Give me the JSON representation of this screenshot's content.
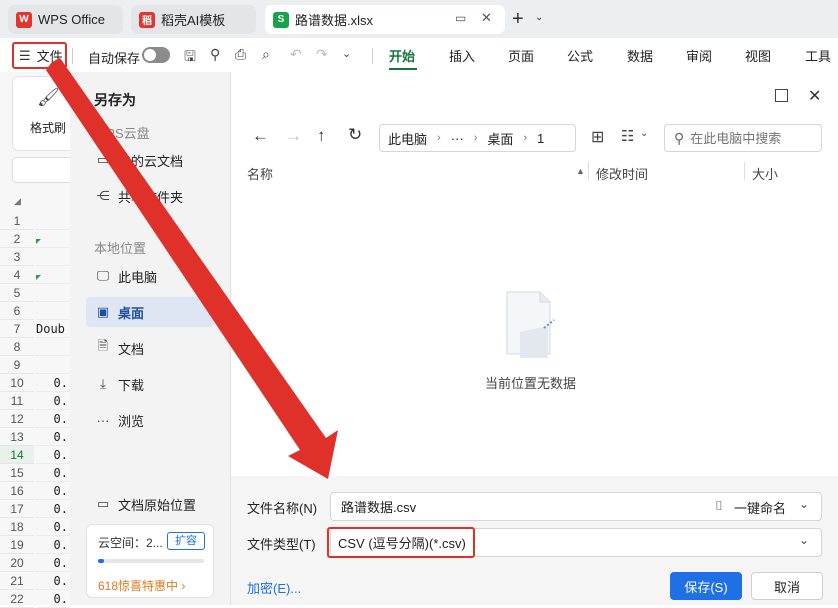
{
  "tabs": [
    {
      "label": "WPS Office",
      "icon": "wps-logo-icon"
    },
    {
      "label": "稻壳AI模板",
      "icon": "docer-logo-icon"
    },
    {
      "label": "路谱数据.xlsx",
      "icon": "spreadsheet-icon",
      "badge": "S"
    }
  ],
  "ribbon": {
    "file_menu": "文件",
    "autosave": "自动保存",
    "menu_tabs": [
      "开始",
      "插入",
      "页面",
      "公式",
      "数据",
      "审阅",
      "视图",
      "工具"
    ],
    "format_painter": "格式刷"
  },
  "sheet": {
    "rows": [
      "1",
      "2",
      "3",
      "4",
      "5",
      "6",
      "7",
      "8",
      "9",
      "10",
      "11",
      "12",
      "13",
      "14",
      "15",
      "16",
      "17",
      "18",
      "19",
      "20",
      "21",
      "22"
    ],
    "row7_text": "Doub",
    "value_prefix": "0."
  },
  "dialog": {
    "title": "另存为",
    "cloud_section": "WPS云盘",
    "cloud_items": [
      {
        "label": "我的云文档",
        "icon": "cloud-folder-icon"
      },
      {
        "label": "共享文件夹",
        "icon": "share-icon"
      }
    ],
    "local_section": "本地位置",
    "local_items": [
      {
        "label": "此电脑",
        "icon": "monitor-icon"
      },
      {
        "label": "桌面",
        "icon": "desktop-icon"
      },
      {
        "label": "文档",
        "icon": "document-icon"
      },
      {
        "label": "下载",
        "icon": "download-icon"
      },
      {
        "label": "浏览",
        "icon": "more-icon"
      }
    ],
    "original_location": "文档原始位置",
    "cloud_space": "云空间：2...",
    "expand": "扩容",
    "promo": "618惊喜特惠中 ›",
    "breadcrumb": [
      "此电脑",
      "···",
      "桌面",
      "1"
    ],
    "search_placeholder": "在此电脑中搜索",
    "columns": {
      "name": "名称",
      "modified": "修改时间",
      "size": "大小"
    },
    "empty_text": "当前位置无数据",
    "filename_label": "文件名称(N)",
    "filename_value": "路谱数据.csv",
    "quick_name": "一键命名",
    "filetype_label": "文件类型(T)",
    "filetype_value": "CSV (逗号分隔)(*.csv)",
    "encrypt": "加密(E)...",
    "save": "保存(S)",
    "cancel": "取消"
  },
  "colors": {
    "accent": "#1f6fe5",
    "annotation_red": "#e0302a",
    "green": "#17753c",
    "promo": "#e07a1a"
  }
}
